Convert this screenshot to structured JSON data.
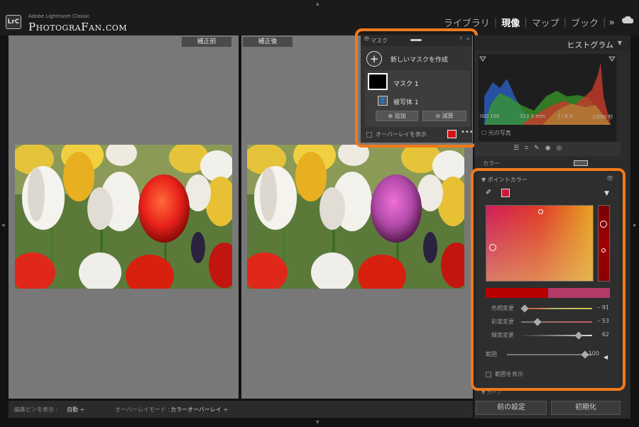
{
  "app": {
    "badge": "LrC",
    "subtitle": "Adobe Lightroom Classic",
    "brand": "PhotograFan.com"
  },
  "modules": {
    "library": "ライブラリ",
    "develop": "現像",
    "map": "マップ",
    "book": "ブック",
    "more": "»"
  },
  "panes": {
    "before_label": "補正前",
    "after_label": "補正後"
  },
  "toolbar": {
    "pin_label": "編集ピンを表示 :",
    "pin_value": "自動 ÷",
    "overlay_mode_label": "オーバーレイモード :",
    "overlay_mode_value": "カラーオーバーレイ ÷"
  },
  "mask_panel": {
    "title": "マスク",
    "create_label": "新しいマスクを作成",
    "mask_name": "マスク 1",
    "subject_label": "被写体 1",
    "add_label": "追加",
    "subtract_label": "減算",
    "overlay_label": "オーバーレイを表示",
    "overlay_color": "#d41515",
    "more": "•••"
  },
  "histogram": {
    "title": "ヒストグラム",
    "iso": "ISO 100",
    "focal": "313.9 mm",
    "aperture": "ƒ / 6.3",
    "shutter": "1/250 秒",
    "original_photo": "元の写真"
  },
  "color_tab": {
    "label": "カラー"
  },
  "point_color": {
    "title": "ポイントカラー",
    "selected_color": "#cc1a3c",
    "hue_label": "色相変更",
    "hue_value": "– 91",
    "hue_fraction": 0.05,
    "sat_label": "彩度変更",
    "sat_value": "– 53",
    "sat_fraction": 0.23,
    "lum_label": "輝度変更",
    "lum_value": "62",
    "lum_fraction": 0.81,
    "range_label": "範囲",
    "range_value": "100",
    "range_fraction": 0.92,
    "show_range_label": "範囲を表示"
  },
  "curve_tab": {
    "label": "カーブ"
  },
  "buttons": {
    "previous": "前の設定",
    "reset": "初期化"
  }
}
